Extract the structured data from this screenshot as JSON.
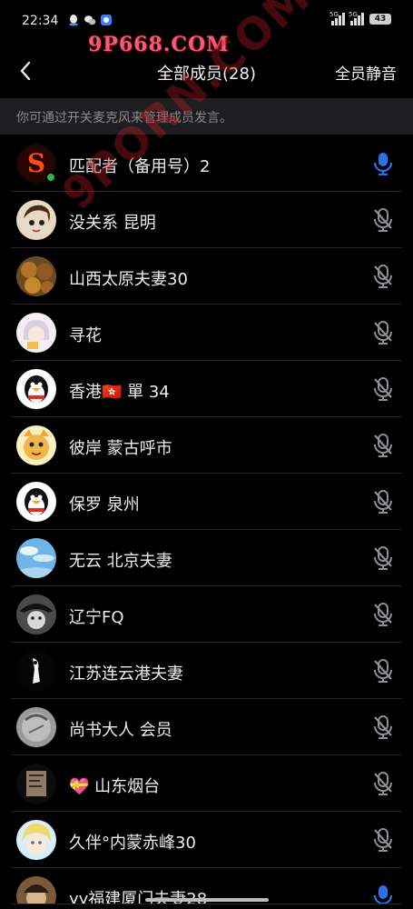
{
  "status": {
    "time": "22:34",
    "sig1_label": "5G",
    "sig2_label": "5G",
    "battery": "43"
  },
  "watermark": {
    "top": "9P668.COM",
    "diagonal": "9PORN.COM"
  },
  "nav": {
    "title": "全部成员(28)",
    "action": "全员静音"
  },
  "tip": "你可通过开关麦克风来管理成员发言。",
  "members": [
    {
      "name": "匹配者（备用号）2",
      "mic": "on"
    },
    {
      "name": "没关系 昆明",
      "mic": "off"
    },
    {
      "name": "山西太原夫妻30",
      "mic": "off"
    },
    {
      "name": "寻花",
      "mic": "off"
    },
    {
      "name": "香港🇭🇰 單 34",
      "mic": "off"
    },
    {
      "name": "彼岸 蒙古呼市",
      "mic": "off"
    },
    {
      "name": "保罗 泉州",
      "mic": "off"
    },
    {
      "name": "无云 北京夫妻",
      "mic": "off"
    },
    {
      "name": "辽宁FQ",
      "mic": "off"
    },
    {
      "name": "江苏连云港夫妻",
      "mic": "off"
    },
    {
      "name": "尚书大人 会员",
      "mic": "off"
    },
    {
      "name": "💝 山东烟台",
      "mic": "off"
    },
    {
      "name": "久伴°内蒙赤峰30",
      "mic": "off"
    },
    {
      "name": "yy福建厦门夫妻28",
      "mic": "on"
    }
  ],
  "colors": {
    "mic_on": "#2f6fe8",
    "mic_off": "#8e8e93"
  }
}
